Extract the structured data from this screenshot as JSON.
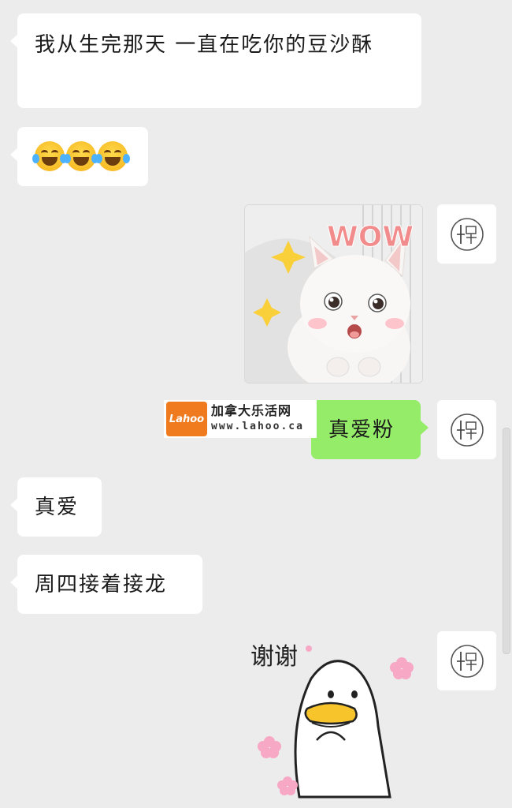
{
  "messages": [
    {
      "side": "left",
      "type": "text",
      "text": "我从生完那天 一直在吃你的豆沙酥"
    },
    {
      "side": "left",
      "type": "emoji",
      "emoji": [
        "face-with-tears-of-joy",
        "face-with-tears-of-joy",
        "face-with-tears-of-joy"
      ]
    },
    {
      "side": "right",
      "type": "sticker",
      "sticker": "cat-wow",
      "text": "WOW"
    },
    {
      "side": "right",
      "type": "text",
      "text": "真爱粉"
    },
    {
      "side": "left",
      "type": "text",
      "text": "真爱"
    },
    {
      "side": "left",
      "type": "text",
      "text": "周四接着接龙"
    },
    {
      "side": "right",
      "type": "sticker",
      "sticker": "duck-thanks",
      "text": "谢谢"
    }
  ],
  "watermark": {
    "logo_text": "Lahoo",
    "title": "加拿大乐活网",
    "url": "www.lahoo.ca"
  },
  "avatar": {
    "icon": "shop-logo-icon"
  },
  "colors": {
    "background": "#ececec",
    "incoming_bubble": "#ffffff",
    "outgoing_bubble": "#95ec69"
  }
}
